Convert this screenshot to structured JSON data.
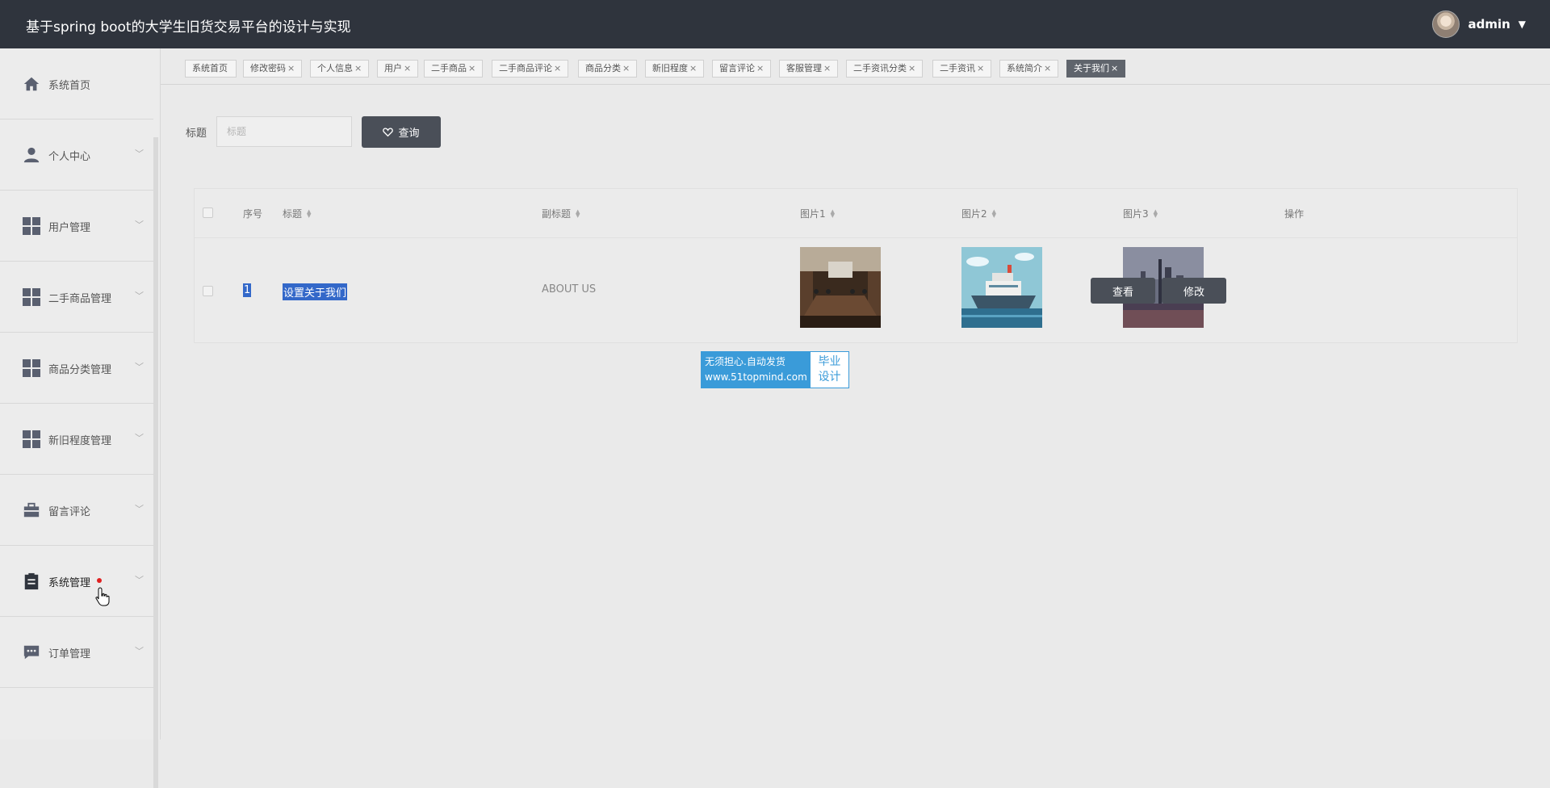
{
  "header": {
    "title": "基于spring boot的大学生旧货交易平台的设计与实现",
    "user_name": "admin",
    "caret": "▼"
  },
  "sidebar": {
    "items": [
      {
        "label": "系统首页",
        "icon": "home-icon",
        "chevron": ""
      },
      {
        "label": "个人中心",
        "icon": "user-icon",
        "chevron": "﹀"
      },
      {
        "label": "用户管理",
        "icon": "grid-icon",
        "chevron": "﹀"
      },
      {
        "label": "二手商品管理",
        "icon": "grid-icon",
        "chevron": "﹀"
      },
      {
        "label": "商品分类管理",
        "icon": "grid-icon",
        "chevron": "﹀"
      },
      {
        "label": "新旧程度管理",
        "icon": "grid-icon",
        "chevron": "﹀"
      },
      {
        "label": "留言评论",
        "icon": "briefcase-icon",
        "chevron": "﹀"
      },
      {
        "label": "系统管理",
        "icon": "clipboard-icon",
        "chevron": "﹀"
      },
      {
        "label": "订单管理",
        "icon": "chat-icon",
        "chevron": "﹀"
      }
    ]
  },
  "tabs": [
    {
      "label": "系统首页",
      "close": ""
    },
    {
      "label": "修改密码",
      "close": "×"
    },
    {
      "label": "个人信息",
      "close": "×"
    },
    {
      "label": "用户",
      "close": "×"
    },
    {
      "label": "二手商品",
      "close": "×"
    },
    {
      "label": "二手商品评论",
      "close": "×"
    },
    {
      "label": "商品分类",
      "close": "×"
    },
    {
      "label": "新旧程度",
      "close": "×"
    },
    {
      "label": "留言评论",
      "close": "×"
    },
    {
      "label": "客服管理",
      "close": "×"
    },
    {
      "label": "二手资讯分类",
      "close": "×"
    },
    {
      "label": "二手资讯",
      "close": "×"
    },
    {
      "label": "系统简介",
      "close": "×"
    },
    {
      "label": "关于我们",
      "close": "×"
    }
  ],
  "search": {
    "label": "标题",
    "placeholder": "标题",
    "value": "",
    "button_label": "查询",
    "button_icon": "heart-icon"
  },
  "table": {
    "columns": {
      "index": "序号",
      "title": "标题",
      "subtitle": "副标题",
      "image1": "图片1",
      "image2": "图片2",
      "image3": "图片3",
      "actions": "操作"
    },
    "sort_up": "▲",
    "sort_down": "▼",
    "rows": [
      {
        "index": "1",
        "title": "设置关于我们",
        "subtitle": "ABOUT US",
        "image1": "meeting-room-photo",
        "image2": "ship-illustration",
        "image3": "city-skyline-photo",
        "view_label": "查看",
        "edit_label": "修改"
      }
    ]
  },
  "watermark": {
    "line1": "无须担心.自动发货",
    "line2": "www.51topmind.com",
    "right1": "毕业",
    "right2": "设计"
  }
}
